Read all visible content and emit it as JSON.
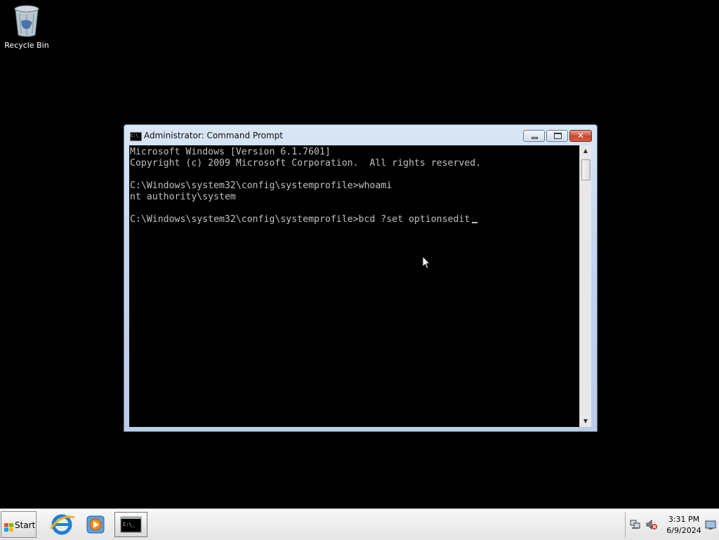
{
  "desktop": {
    "icons": [
      {
        "label": "Recycle Bin",
        "icon": "recycle-bin-icon"
      }
    ]
  },
  "window": {
    "title": "Administrator: Command Prompt",
    "icon": "cmd-icon",
    "controls": {
      "minimize": "minimize-icon",
      "maximize": "maximize-icon",
      "close": "close-icon"
    },
    "console_lines": [
      "Microsoft Windows [Version 6.1.7601]",
      "Copyright (c) 2009 Microsoft Corporation.  All rights reserved.",
      "",
      "C:\\Windows\\system32\\config\\systemprofile>whoami",
      "nt authority\\system",
      "",
      "C:\\Windows\\system32\\config\\systemprofile>bcd ?set optionsedit"
    ]
  },
  "taskbar": {
    "start_label": "Start",
    "pinned": [
      {
        "name": "Internet Explorer",
        "icon": "internet-explorer-icon"
      },
      {
        "name": "Windows Media Player",
        "icon": "media-player-icon"
      },
      {
        "name": "Command Prompt",
        "icon": "cmd-icon",
        "active": true
      }
    ],
    "tray": {
      "network_icon": "network-icon",
      "volume_icon": "volume-muted-icon",
      "time": "3:31 PM",
      "date": "6/9/2024"
    }
  },
  "colors": {
    "desktop_bg": "#000000",
    "console_text": "#c0c0c0",
    "close_button": "#c9462c"
  }
}
